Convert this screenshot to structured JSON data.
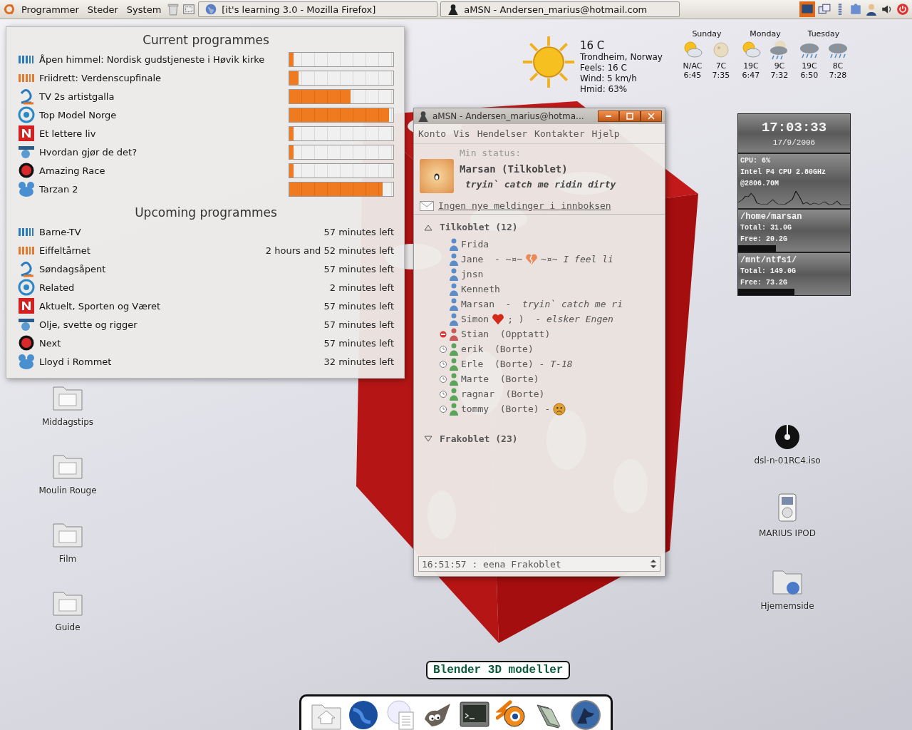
{
  "top_panel": {
    "menus": [
      "Programmer",
      "Steder",
      "System"
    ],
    "tasks": [
      {
        "title": "[it's learning 3.0 - Mozilla Firefox]",
        "kind": "browser"
      },
      {
        "title": "aMSN - Andersen_marius@hotmail.com",
        "kind": "messenger"
      }
    ]
  },
  "current_programmes": {
    "title": "Current programmes",
    "items": [
      {
        "kind": "nrk1",
        "name": "Åpen himmel: Nordisk gudstjeneste i Høvik kirke",
        "level": 0.04
      },
      {
        "kind": "nrk2",
        "name": "Friidrett: Verdenscupfinale",
        "level": 0.09
      },
      {
        "kind": "tv2",
        "name": "TV 2s artistgalla",
        "level": 0.59
      },
      {
        "kind": "tv3",
        "name": "Top Model Norge",
        "level": 0.96
      },
      {
        "kind": "tvnorge",
        "name": "Et lettere liv",
        "level": 0.04
      },
      {
        "kind": "discovery",
        "name": "Hvordan gjør de det?",
        "level": 0.04
      },
      {
        "kind": "zone",
        "name": "Amazing Race",
        "level": 0.04
      },
      {
        "kind": "disney",
        "name": "Tarzan 2",
        "level": 0.9
      }
    ]
  },
  "upcoming_programmes": {
    "title": "Upcoming programmes",
    "items": [
      {
        "kind": "nrk1",
        "name": "Barne-TV",
        "remaining": "57 minutes left"
      },
      {
        "kind": "nrk2",
        "name": "Eiffeltårnet",
        "remaining": "2 hours and 52 minutes left"
      },
      {
        "kind": "tv2",
        "name": "Søndagsåpent",
        "remaining": "57 minutes left"
      },
      {
        "kind": "tv3",
        "name": "Related",
        "remaining": "2 minutes left"
      },
      {
        "kind": "tvnorge",
        "name": "Aktuelt, Sporten og Været",
        "remaining": "57 minutes left"
      },
      {
        "kind": "discovery",
        "name": "Olje, svette og rigger",
        "remaining": "57 minutes left"
      },
      {
        "kind": "zone",
        "name": "Next",
        "remaining": "57 minutes left"
      },
      {
        "kind": "disney",
        "name": "Lloyd i Rommet",
        "remaining": "32 minutes left"
      }
    ]
  },
  "weather": {
    "temperature": "16 C",
    "location": "Trondheim, Norway",
    "feels": "Feels: 16 C",
    "wind": "Wind: 5 km/h",
    "humidity": "Hmid: 63%",
    "days": [
      {
        "day": "Sunday",
        "periods": [
          {
            "kind": "sun-cloud",
            "temp": "N/AC",
            "time": "6:45"
          },
          {
            "kind": "moon",
            "temp": "7C",
            "time": "7:35"
          }
        ]
      },
      {
        "day": "Monday",
        "periods": [
          {
            "kind": "sun-cloud",
            "temp": "19C",
            "time": "6:47"
          },
          {
            "kind": "moon-rain",
            "temp": "9C",
            "time": "7:32"
          }
        ]
      },
      {
        "day": "Tuesday",
        "periods": [
          {
            "kind": "rain",
            "temp": "19C",
            "time": "6:50"
          },
          {
            "kind": "rain",
            "temp": "8C",
            "time": "7:28"
          }
        ]
      }
    ]
  },
  "system_monitor": {
    "time": "17:03:33",
    "date": "17/9/2006",
    "cpu": "CPU: 6%",
    "cpu_model": "Intel P4 CPU 2.80GHz",
    "cpu_speed": "@2806.70M",
    "disks": [
      {
        "path": "/home/marsan",
        "total": "Total: 31.0G",
        "free": "Free: 20.2G",
        "level": 0.34
      },
      {
        "path": "/mnt/ntfs1/",
        "total": "Total: 149.0G",
        "free": "Free: 73.2G",
        "level": 0.5
      }
    ]
  },
  "amsn": {
    "title": "aMSN - Andersen_marius@hotma...",
    "menu": [
      "Konto",
      "Vis",
      "Hendelser",
      "Kontakter",
      "Hjelp"
    ],
    "status_label": "Min status:",
    "user": "Marsan (Tilkoblet)",
    "personal_message": "tryin` catch me ridin dirty",
    "mail": "Ingen nye meldinger i innboksen",
    "groups": [
      {
        "name": "Tilkoblet (12)",
        "expanded": true,
        "contacts": [
          {
            "kind": "online",
            "parts": [
              {
                "kind": "text",
                "text": "Frida"
              }
            ]
          },
          {
            "kind": "online",
            "parts": [
              {
                "kind": "text",
                "text": "Jane  - ~¤~"
              },
              {
                "kind": "broken-heart"
              },
              {
                "kind": "text",
                "text": "~¤~ *I feel li*"
              }
            ]
          },
          {
            "kind": "online",
            "parts": [
              {
                "kind": "text",
                "text": "jnsn"
              }
            ]
          },
          {
            "kind": "online",
            "parts": [
              {
                "kind": "text",
                "text": "Kenneth"
              }
            ]
          },
          {
            "kind": "online",
            "parts": [
              {
                "kind": "text",
                "text": "Marsan  -  *tryin` catch me ri*"
              }
            ]
          },
          {
            "kind": "online",
            "parts": [
              {
                "kind": "text",
                "text": "Simon"
              },
              {
                "kind": "heart"
              },
              {
                "kind": "text",
                "text": "; )  - *elsker Engen*"
              }
            ]
          },
          {
            "kind": "busy",
            "parts": [
              {
                "kind": "text",
                "text": "Stian  (Opptatt)"
              }
            ]
          },
          {
            "kind": "away",
            "parts": [
              {
                "kind": "text",
                "text": "erik  (Borte)"
              }
            ]
          },
          {
            "kind": "away",
            "parts": [
              {
                "kind": "text",
                "text": "Erle  (Borte) - *T-18*"
              }
            ]
          },
          {
            "kind": "away",
            "parts": [
              {
                "kind": "text",
                "text": "Marte  (Borte)"
              }
            ]
          },
          {
            "kind": "away",
            "parts": [
              {
                "kind": "text",
                "text": "ragnar  (Borte)"
              }
            ]
          },
          {
            "kind": "away",
            "parts": [
              {
                "kind": "text",
                "text": "tommy  (Borte) -"
              },
              {
                "kind": "sad-face"
              }
            ]
          }
        ]
      },
      {
        "name": "Frakoblet (23)",
        "expanded": false
      }
    ],
    "status_bar": "16:51:57 : eena Frakoblet"
  },
  "desktop_left": [
    "Middagstips",
    "Moulin Rouge",
    "Film",
    "Guide"
  ],
  "desktop_right": [
    {
      "kind": "disc",
      "label": "dsl-n-01RC4.iso"
    },
    {
      "kind": "player",
      "label": "MARIUS IPOD"
    },
    {
      "kind": "web-folder",
      "label": "Hjememside"
    }
  ],
  "dock": {
    "tooltip": "Blender 3D modeller"
  }
}
